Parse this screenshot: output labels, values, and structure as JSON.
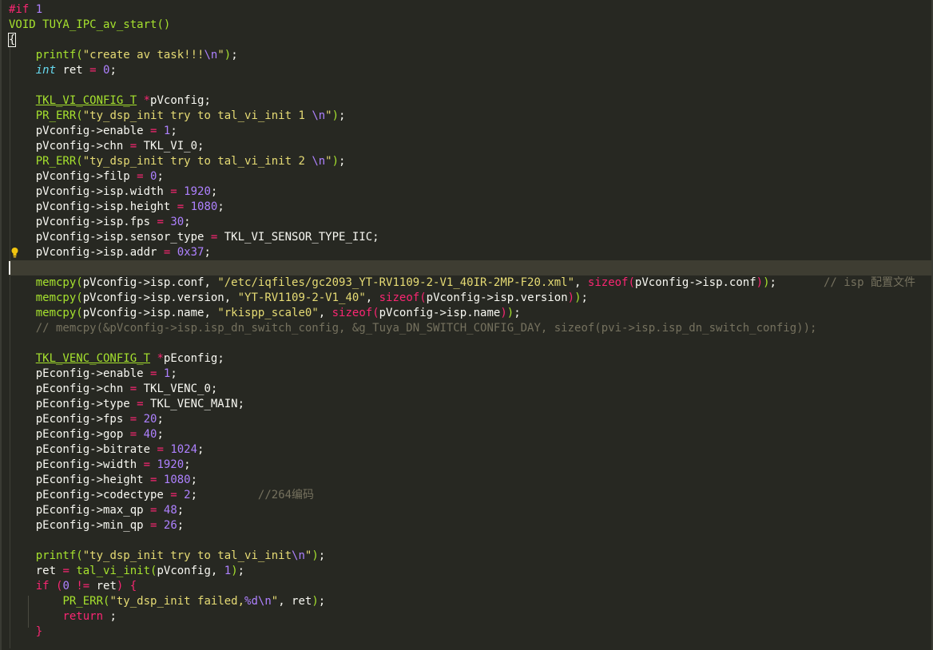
{
  "colors": {
    "background": "#272822",
    "current_line": "#3e3d32",
    "keyword": "#f92672",
    "number": "#ae81ff",
    "string": "#e6db74",
    "function": "#a6e22e",
    "type": "#66d9ef",
    "comment": "#75715e",
    "text": "#f8f8f2",
    "bulb": "#f1c40f"
  },
  "icons": {
    "gutter": "lightbulb-icon"
  },
  "code": {
    "lines": [
      {
        "tokens": [
          [
            "kw",
            "#if "
          ],
          [
            "num",
            "1"
          ]
        ]
      },
      {
        "tokens": [
          [
            "fn",
            "VOID TUYA_IPC_av_start"
          ],
          [
            "fn",
            "()"
          ]
        ]
      },
      {
        "tokens": [
          [
            "brace",
            "{"
          ]
        ]
      },
      {
        "tokens": [
          [
            "txt",
            "    "
          ],
          [
            "fn",
            "printf"
          ],
          [
            "fn",
            "("
          ],
          [
            "str",
            "\"create av task!!!"
          ],
          [
            "esc",
            "\\n"
          ],
          [
            "str",
            "\""
          ],
          [
            "fn",
            ")"
          ],
          [
            "txt",
            ";"
          ]
        ]
      },
      {
        "tokens": [
          [
            "txt",
            "    "
          ],
          [
            "type",
            "int"
          ],
          [
            "txt",
            " ret "
          ],
          [
            "kw",
            "="
          ],
          [
            "txt",
            " "
          ],
          [
            "num",
            "0"
          ],
          [
            "txt",
            ";"
          ]
        ]
      },
      {
        "tokens": []
      },
      {
        "tokens": [
          [
            "txt",
            "    "
          ],
          [
            "typeu",
            "TKL_VI_CONFIG_T"
          ],
          [
            "txt",
            " "
          ],
          [
            "kw",
            "*"
          ],
          [
            "txt",
            "pVconfig;"
          ]
        ]
      },
      {
        "tokens": [
          [
            "txt",
            "    "
          ],
          [
            "fn",
            "PR_ERR"
          ],
          [
            "fn",
            "("
          ],
          [
            "str",
            "\"ty_dsp_init try to tal_vi_init 1 "
          ],
          [
            "esc",
            "\\n"
          ],
          [
            "str",
            "\""
          ],
          [
            "fn",
            ")"
          ],
          [
            "txt",
            ";"
          ]
        ]
      },
      {
        "tokens": [
          [
            "txt",
            "    pVconfig->enable "
          ],
          [
            "kw",
            "="
          ],
          [
            "txt",
            " "
          ],
          [
            "num",
            "1"
          ],
          [
            "txt",
            ";"
          ]
        ]
      },
      {
        "tokens": [
          [
            "txt",
            "    pVconfig->chn "
          ],
          [
            "kw",
            "="
          ],
          [
            "txt",
            " TKL_VI_0;"
          ]
        ]
      },
      {
        "tokens": [
          [
            "txt",
            "    "
          ],
          [
            "fn",
            "PR_ERR"
          ],
          [
            "fn",
            "("
          ],
          [
            "str",
            "\"ty_dsp_init try to tal_vi_init 2 "
          ],
          [
            "esc",
            "\\n"
          ],
          [
            "str",
            "\""
          ],
          [
            "fn",
            ")"
          ],
          [
            "txt",
            ";"
          ]
        ]
      },
      {
        "tokens": [
          [
            "txt",
            "    pVconfig->filp "
          ],
          [
            "kw",
            "="
          ],
          [
            "txt",
            " "
          ],
          [
            "num",
            "0"
          ],
          [
            "txt",
            ";"
          ]
        ]
      },
      {
        "tokens": [
          [
            "txt",
            "    pVconfig->isp.width "
          ],
          [
            "kw",
            "="
          ],
          [
            "txt",
            " "
          ],
          [
            "num",
            "1920"
          ],
          [
            "txt",
            ";"
          ]
        ]
      },
      {
        "tokens": [
          [
            "txt",
            "    pVconfig->isp.height "
          ],
          [
            "kw",
            "="
          ],
          [
            "txt",
            " "
          ],
          [
            "num",
            "1080"
          ],
          [
            "txt",
            ";"
          ]
        ]
      },
      {
        "tokens": [
          [
            "txt",
            "    pVconfig->isp.fps "
          ],
          [
            "kw",
            "="
          ],
          [
            "txt",
            " "
          ],
          [
            "num",
            "30"
          ],
          [
            "txt",
            ";"
          ]
        ]
      },
      {
        "tokens": [
          [
            "txt",
            "    pVconfig->isp.sensor_type "
          ],
          [
            "kw",
            "="
          ],
          [
            "txt",
            " TKL_VI_SENSOR_TYPE_IIC;"
          ]
        ]
      },
      {
        "bulb": true,
        "tokens": [
          [
            "txt",
            "    pVconfig->isp.addr "
          ],
          [
            "kw",
            "="
          ],
          [
            "txt",
            " "
          ],
          [
            "num",
            "0x37"
          ],
          [
            "txt",
            ";"
          ]
        ]
      },
      {
        "current": true,
        "tokens": []
      },
      {
        "tokens": [
          [
            "txt",
            "    "
          ],
          [
            "fn",
            "memcpy"
          ],
          [
            "fn",
            "("
          ],
          [
            "txt",
            "pVconfig->isp.conf, "
          ],
          [
            "str",
            "\"/etc/iqfiles/gc2093_YT-RV1109-2-V1_40IR-2MP-F20.xml\""
          ],
          [
            "txt",
            ", "
          ],
          [
            "kw",
            "sizeof"
          ],
          [
            "kw",
            "("
          ],
          [
            "txt",
            "pVconfig->isp.conf"
          ],
          [
            "kw",
            ")"
          ],
          [
            "fn",
            ")"
          ],
          [
            "txt",
            ";       "
          ],
          [
            "cm",
            "// isp 配置文件  "
          ]
        ]
      },
      {
        "tokens": [
          [
            "txt",
            "    "
          ],
          [
            "fn",
            "memcpy"
          ],
          [
            "fn",
            "("
          ],
          [
            "txt",
            "pVconfig->isp.version, "
          ],
          [
            "str",
            "\"YT-RV1109-2-V1_40\""
          ],
          [
            "txt",
            ", "
          ],
          [
            "kw",
            "sizeof"
          ],
          [
            "kw",
            "("
          ],
          [
            "txt",
            "pVconfig->isp.version"
          ],
          [
            "kw",
            ")"
          ],
          [
            "fn",
            ")"
          ],
          [
            "txt",
            ";"
          ]
        ]
      },
      {
        "tokens": [
          [
            "txt",
            "    "
          ],
          [
            "fn",
            "memcpy"
          ],
          [
            "fn",
            "("
          ],
          [
            "txt",
            "pVconfig->isp.name, "
          ],
          [
            "str",
            "\"rkispp_scale0\""
          ],
          [
            "txt",
            ", "
          ],
          [
            "kw",
            "sizeof"
          ],
          [
            "kw",
            "("
          ],
          [
            "txt",
            "pVconfig->isp.name"
          ],
          [
            "kw",
            ")"
          ],
          [
            "fn",
            ")"
          ],
          [
            "txt",
            ";"
          ]
        ]
      },
      {
        "tokens": [
          [
            "txt",
            "    "
          ],
          [
            "cm",
            "// memcpy(&pVconfig->isp.isp_dn_switch_config, &g_Tuya_DN_SWITCH_CONFIG_DAY, sizeof(pvi->isp.isp_dn_switch_config));"
          ]
        ]
      },
      {
        "tokens": []
      },
      {
        "tokens": [
          [
            "txt",
            "    "
          ],
          [
            "typeu",
            "TKL_VENC_CONFIG_T"
          ],
          [
            "txt",
            " "
          ],
          [
            "kw",
            "*"
          ],
          [
            "txt",
            "pEconfig;"
          ]
        ]
      },
      {
        "tokens": [
          [
            "txt",
            "    pEconfig->enable "
          ],
          [
            "kw",
            "="
          ],
          [
            "txt",
            " "
          ],
          [
            "num",
            "1"
          ],
          [
            "txt",
            ";"
          ]
        ]
      },
      {
        "tokens": [
          [
            "txt",
            "    pEconfig->chn "
          ],
          [
            "kw",
            "="
          ],
          [
            "txt",
            " TKL_VENC_0;"
          ]
        ]
      },
      {
        "tokens": [
          [
            "txt",
            "    pEconfig->type "
          ],
          [
            "kw",
            "="
          ],
          [
            "txt",
            " TKL_VENC_MAIN;"
          ]
        ]
      },
      {
        "tokens": [
          [
            "txt",
            "    pEconfig->fps "
          ],
          [
            "kw",
            "="
          ],
          [
            "txt",
            " "
          ],
          [
            "num",
            "20"
          ],
          [
            "txt",
            ";"
          ]
        ]
      },
      {
        "tokens": [
          [
            "txt",
            "    pEconfig->gop "
          ],
          [
            "kw",
            "="
          ],
          [
            "txt",
            " "
          ],
          [
            "num",
            "40"
          ],
          [
            "txt",
            ";"
          ]
        ]
      },
      {
        "tokens": [
          [
            "txt",
            "    pEconfig->bitrate "
          ],
          [
            "kw",
            "="
          ],
          [
            "txt",
            " "
          ],
          [
            "num",
            "1024"
          ],
          [
            "txt",
            ";"
          ]
        ]
      },
      {
        "tokens": [
          [
            "txt",
            "    pEconfig->width "
          ],
          [
            "kw",
            "="
          ],
          [
            "txt",
            " "
          ],
          [
            "num",
            "1920"
          ],
          [
            "txt",
            ";"
          ]
        ]
      },
      {
        "tokens": [
          [
            "txt",
            "    pEconfig->height "
          ],
          [
            "kw",
            "="
          ],
          [
            "txt",
            " "
          ],
          [
            "num",
            "1080"
          ],
          [
            "txt",
            ";"
          ]
        ]
      },
      {
        "tokens": [
          [
            "txt",
            "    pEconfig->codectype "
          ],
          [
            "kw",
            "="
          ],
          [
            "txt",
            " "
          ],
          [
            "num",
            "2"
          ],
          [
            "txt",
            ";         "
          ],
          [
            "cm",
            "//264编码"
          ]
        ]
      },
      {
        "tokens": [
          [
            "txt",
            "    pEconfig->max_qp "
          ],
          [
            "kw",
            "="
          ],
          [
            "txt",
            " "
          ],
          [
            "num",
            "48"
          ],
          [
            "txt",
            ";"
          ]
        ]
      },
      {
        "tokens": [
          [
            "txt",
            "    pEconfig->min_qp "
          ],
          [
            "kw",
            "="
          ],
          [
            "txt",
            " "
          ],
          [
            "num",
            "26"
          ],
          [
            "txt",
            ";"
          ]
        ]
      },
      {
        "tokens": []
      },
      {
        "tokens": [
          [
            "txt",
            "    "
          ],
          [
            "fn",
            "printf"
          ],
          [
            "fn",
            "("
          ],
          [
            "str",
            "\"ty_dsp_init try to tal_vi_init"
          ],
          [
            "esc",
            "\\n"
          ],
          [
            "str",
            "\""
          ],
          [
            "fn",
            ")"
          ],
          [
            "txt",
            ";"
          ]
        ]
      },
      {
        "tokens": [
          [
            "txt",
            "    ret "
          ],
          [
            "kw",
            "="
          ],
          [
            "txt",
            " "
          ],
          [
            "fn",
            "tal_vi_init"
          ],
          [
            "fn",
            "("
          ],
          [
            "txt",
            "pVconfig, "
          ],
          [
            "num",
            "1"
          ],
          [
            "fn",
            ")"
          ],
          [
            "txt",
            ";"
          ]
        ]
      },
      {
        "tokens": [
          [
            "txt",
            "    "
          ],
          [
            "kw",
            "if"
          ],
          [
            "txt",
            " "
          ],
          [
            "kw",
            "("
          ],
          [
            "num",
            "0"
          ],
          [
            "txt",
            " "
          ],
          [
            "kw",
            "!="
          ],
          [
            "txt",
            " ret"
          ],
          [
            "kw",
            ")"
          ],
          [
            "txt",
            " "
          ],
          [
            "kw",
            "{"
          ]
        ]
      },
      {
        "tokens": [
          [
            "txt",
            "        "
          ],
          [
            "fn",
            "PR_ERR"
          ],
          [
            "fn",
            "("
          ],
          [
            "str",
            "\"ty_dsp_init failed,"
          ],
          [
            "esc",
            "%d\\n"
          ],
          [
            "str",
            "\""
          ],
          [
            "txt",
            ", ret"
          ],
          [
            "fn",
            ")"
          ],
          [
            "txt",
            ";"
          ]
        ]
      },
      {
        "tokens": [
          [
            "txt",
            "        "
          ],
          [
            "kw",
            "return"
          ],
          [
            "txt",
            " ;"
          ]
        ]
      },
      {
        "tokens": [
          [
            "txt",
            "    "
          ],
          [
            "kw",
            "}"
          ]
        ]
      }
    ]
  }
}
